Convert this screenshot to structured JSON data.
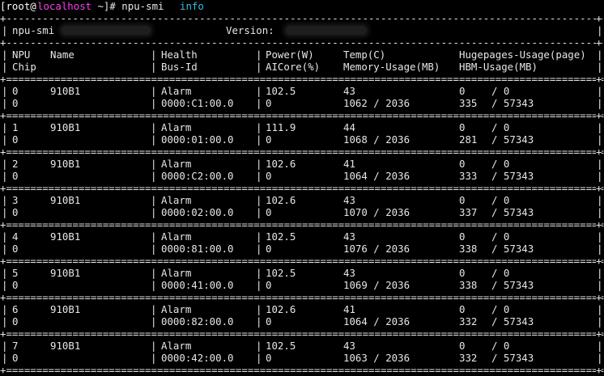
{
  "prompt": {
    "open": "[root@",
    "host": "localhost",
    "rest": " ~]# npu-smi ",
    "arg": "info"
  },
  "summary": {
    "tool_label": "npu-smi",
    "version_label": "Version:"
  },
  "headers": {
    "row1": [
      "NPU",
      "Name",
      "Health",
      "Power(W)",
      "Temp(C)",
      "Hugepages-Usage(page)"
    ],
    "row2": [
      "Chip",
      "",
      "Bus-Id",
      "AICore(%)",
      "Memory-Usage(MB)",
      "HBM-Usage(MB)"
    ]
  },
  "npus": [
    {
      "npu": "0",
      "name": "910B1",
      "health": "Alarm",
      "power": "102.5",
      "temp": "43",
      "hp_used": "0",
      "hp_total": "/ 0",
      "chip": "0",
      "bus": "0000:C1:00.0",
      "aicore": "0",
      "mem": "1062 / 2036",
      "hbm_used": "335",
      "hbm_total": "/ 57343"
    },
    {
      "npu": "1",
      "name": "910B1",
      "health": "Alarm",
      "power": "111.9",
      "temp": "44",
      "hp_used": "0",
      "hp_total": "/ 0",
      "chip": "0",
      "bus": "0000:01:00.0",
      "aicore": "0",
      "mem": "1068 / 2036",
      "hbm_used": "281",
      "hbm_total": "/ 57343"
    },
    {
      "npu": "2",
      "name": "910B1",
      "health": "Alarm",
      "power": "102.6",
      "temp": "41",
      "hp_used": "0",
      "hp_total": "/ 0",
      "chip": "0",
      "bus": "0000:C2:00.0",
      "aicore": "0",
      "mem": "1064 / 2036",
      "hbm_used": "333",
      "hbm_total": "/ 57343"
    },
    {
      "npu": "3",
      "name": "910B1",
      "health": "Alarm",
      "power": "102.6",
      "temp": "43",
      "hp_used": "0",
      "hp_total": "/ 0",
      "chip": "0",
      "bus": "0000:02:00.0",
      "aicore": "0",
      "mem": "1070 / 2036",
      "hbm_used": "337",
      "hbm_total": "/ 57343"
    },
    {
      "npu": "4",
      "name": "910B1",
      "health": "Alarm",
      "power": "102.5",
      "temp": "43",
      "hp_used": "0",
      "hp_total": "/ 0",
      "chip": "0",
      "bus": "0000:81:00.0",
      "aicore": "0",
      "mem": "1076 / 2036",
      "hbm_used": "338",
      "hbm_total": "/ 57343"
    },
    {
      "npu": "5",
      "name": "910B1",
      "health": "Alarm",
      "power": "102.5",
      "temp": "43",
      "hp_used": "0",
      "hp_total": "/ 0",
      "chip": "0",
      "bus": "0000:41:00.0",
      "aicore": "0",
      "mem": "1069 / 2036",
      "hbm_used": "338",
      "hbm_total": "/ 57343"
    },
    {
      "npu": "6",
      "name": "910B1",
      "health": "Alarm",
      "power": "102.6",
      "temp": "41",
      "hp_used": "0",
      "hp_total": "/ 0",
      "chip": "0",
      "bus": "0000:82:00.0",
      "aicore": "0",
      "mem": "1064 / 2036",
      "hbm_used": "332",
      "hbm_total": "/ 57343"
    },
    {
      "npu": "7",
      "name": "910B1",
      "health": "Alarm",
      "power": "102.5",
      "temp": "43",
      "hp_used": "0",
      "hp_total": "/ 0",
      "chip": "0",
      "bus": "0000:42:00.0",
      "aicore": "0",
      "mem": "1063 / 2036",
      "hbm_used": "332",
      "hbm_total": "/ 57343"
    }
  ]
}
